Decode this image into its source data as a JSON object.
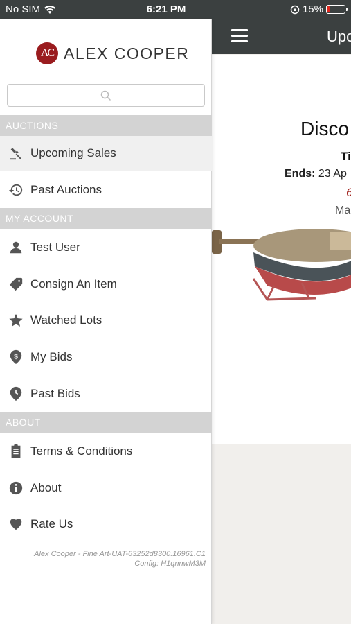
{
  "status_bar": {
    "carrier": "No SIM",
    "time": "6:21 PM",
    "battery_percent": "15%",
    "battery_level": 0.15
  },
  "main": {
    "header_title": "Upc",
    "sale_title": "Disco",
    "sale_sub": "Ti",
    "ends_label": "Ends:",
    "ends_value": "23 Ap",
    "countdown_partial": "6",
    "location_partial": "Ma"
  },
  "drawer": {
    "brand": {
      "monogram": "AC",
      "name": "ALEX COOPER"
    },
    "search": {
      "placeholder": ""
    },
    "sections": {
      "auctions": "AUCTIONS",
      "my_account": "MY ACCOUNT",
      "about": "ABOUT"
    },
    "items": {
      "upcoming_sales": "Upcoming Sales",
      "past_auctions": "Past Auctions",
      "test_user": "Test User",
      "consign": "Consign An Item",
      "watched_lots": "Watched Lots",
      "my_bids": "My Bids",
      "past_bids": "Past Bids",
      "terms": "Terms & Conditions",
      "about": "About",
      "rate_us": "Rate Us"
    },
    "footer": {
      "line1": "Alex Cooper - Fine Art-UAT-63252d8300.16961.C1",
      "line2": "Config: H1qnnwM3M"
    }
  },
  "colors": {
    "header_bg": "#3b4040",
    "brand_red": "#9a1c1f",
    "section_bg": "#d3d3d3",
    "battery_low": "#e0281e"
  }
}
